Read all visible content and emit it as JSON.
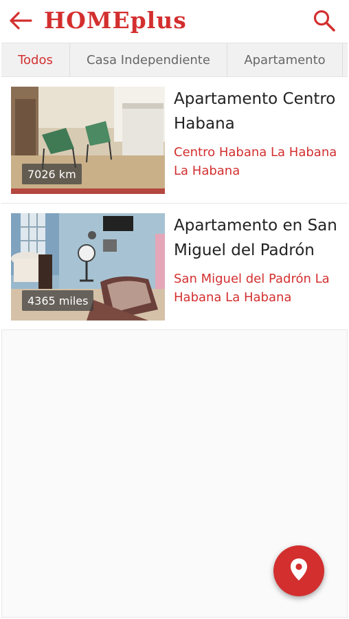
{
  "appbar": {
    "title": "HOMEplus",
    "back_icon": "arrow-left-icon",
    "search_icon": "search-icon",
    "accent_color": "#d32f2f"
  },
  "tabs": [
    {
      "label": "Todos",
      "active": true
    },
    {
      "label": "Casa Independiente",
      "active": false
    },
    {
      "label": "Apartamento",
      "active": false
    }
  ],
  "listings": [
    {
      "title": "Apartamento Centro Habana",
      "location": "Centro Habana La Habana La Habana",
      "distance": "7026 km"
    },
    {
      "title": "Apartamento en San Miguel del Padrón",
      "location": "San Miguel del Padrón La Habana La Habana",
      "distance": "4365 miles"
    }
  ],
  "fab": {
    "icon": "location-pin-icon"
  }
}
